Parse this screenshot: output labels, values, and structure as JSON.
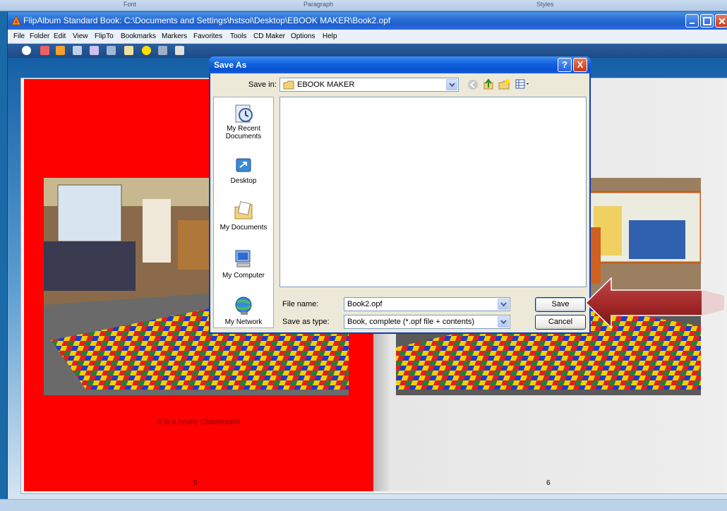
{
  "ribbon": {
    "labels": [
      "Font",
      "Paragraph",
      "Styles"
    ]
  },
  "window": {
    "title": "FlipAlbum Standard    Book: C:\\Documents and Settings\\hstsoi\\Desktop\\EBOOK MAKER\\Book2.opf"
  },
  "menu": [
    "File",
    "Folder",
    "Edit",
    "View",
    "FlipTo",
    "Bookmarks",
    "Markers",
    "Favorites",
    "Tools",
    "CD Maker",
    "Options",
    "Help"
  ],
  "book": {
    "left_caption": "It is a lovely Classroom!",
    "left_page_number": "5",
    "right_page_number": "6"
  },
  "dialog": {
    "title": "Save As",
    "save_in_label": "Save in:",
    "save_in_value": "EBOOK MAKER",
    "places": [
      "My Recent Documents",
      "Desktop",
      "My Documents",
      "My Computer",
      "My Network"
    ],
    "file_name_label": "File name:",
    "file_name_value": "Book2.opf",
    "save_as_type_label": "Save as type:",
    "save_as_type_value": "Book, complete (*.opf file + contents)",
    "save_button": "Save",
    "cancel_button": "Cancel",
    "help_glyph": "?",
    "close_glyph": "X"
  },
  "colors": {
    "left_page": "#ff0000",
    "title_blue": "#0a50d0",
    "arrow": "#a52a2a"
  }
}
